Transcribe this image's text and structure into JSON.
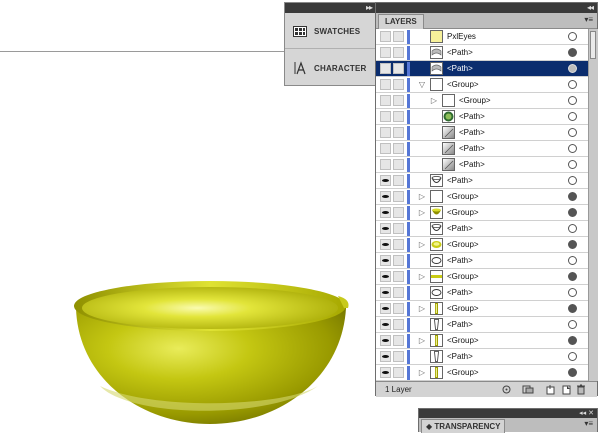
{
  "dock": {
    "swatches_label": "SWATCHES",
    "character_label": "CHARACTER",
    "collapse_glyph": "▸▸"
  },
  "layers": {
    "tab_label": "LAYERS",
    "menu_glyph": "▾≡",
    "collapse_glyph": "◂◂",
    "footer_count": "1 Layer",
    "rows": [
      {
        "label": "PxlEyes",
        "visible": false,
        "expander": "none",
        "thumb": "yellow",
        "indent": 0,
        "targeted": false,
        "selected": false
      },
      {
        "label": "<Path>",
        "visible": false,
        "expander": "none",
        "thumb": "arc",
        "indent": 0,
        "targeted": true,
        "selected": false
      },
      {
        "label": "<Path>",
        "visible": false,
        "expander": "none",
        "thumb": "arc",
        "indent": 0,
        "targeted": true,
        "selected": true
      },
      {
        "label": "<Group>",
        "visible": false,
        "expander": "open",
        "thumb": "blank",
        "indent": 0,
        "targeted": false,
        "selected": false
      },
      {
        "label": "<Group>",
        "visible": false,
        "expander": "closed",
        "thumb": "blank",
        "indent": 1,
        "targeted": false,
        "selected": false
      },
      {
        "label": "<Path>",
        "visible": false,
        "expander": "none",
        "thumb": "green-circle",
        "indent": 1,
        "targeted": false,
        "selected": false
      },
      {
        "label": "<Path>",
        "visible": false,
        "expander": "none",
        "thumb": "gray-grad",
        "indent": 1,
        "targeted": false,
        "selected": false
      },
      {
        "label": "<Path>",
        "visible": false,
        "expander": "none",
        "thumb": "gray-grad",
        "indent": 1,
        "targeted": false,
        "selected": false
      },
      {
        "label": "<Path>",
        "visible": false,
        "expander": "none",
        "thumb": "gray-grad",
        "indent": 1,
        "targeted": false,
        "selected": false
      },
      {
        "label": "<Path>",
        "visible": true,
        "expander": "none",
        "thumb": "bowl-outline",
        "indent": 0,
        "targeted": false,
        "selected": false
      },
      {
        "label": "<Group>",
        "visible": true,
        "expander": "closed",
        "thumb": "blank",
        "indent": 0,
        "targeted": true,
        "selected": false
      },
      {
        "label": "<Group>",
        "visible": true,
        "expander": "closed",
        "thumb": "olive-bowl",
        "indent": 0,
        "targeted": true,
        "selected": false
      },
      {
        "label": "<Path>",
        "visible": true,
        "expander": "none",
        "thumb": "bowl-outline",
        "indent": 0,
        "targeted": false,
        "selected": false
      },
      {
        "label": "<Group>",
        "visible": true,
        "expander": "closed",
        "thumb": "yellow-ellipse",
        "indent": 0,
        "targeted": true,
        "selected": false
      },
      {
        "label": "<Path>",
        "visible": true,
        "expander": "none",
        "thumb": "ring",
        "indent": 0,
        "targeted": false,
        "selected": false
      },
      {
        "label": "<Group>",
        "visible": true,
        "expander": "closed",
        "thumb": "yellow-bar",
        "indent": 0,
        "targeted": true,
        "selected": false
      },
      {
        "label": "<Path>",
        "visible": true,
        "expander": "none",
        "thumb": "ring",
        "indent": 0,
        "targeted": false,
        "selected": false
      },
      {
        "label": "<Group>",
        "visible": true,
        "expander": "closed",
        "thumb": "vertical-bar",
        "indent": 0,
        "targeted": true,
        "selected": false
      },
      {
        "label": "<Path>",
        "visible": true,
        "expander": "none",
        "thumb": "vertical-outline",
        "indent": 0,
        "targeted": false,
        "selected": false
      },
      {
        "label": "<Group>",
        "visible": true,
        "expander": "closed",
        "thumb": "vertical-bar",
        "indent": 0,
        "targeted": true,
        "selected": false
      },
      {
        "label": "<Path>",
        "visible": true,
        "expander": "none",
        "thumb": "vertical-outline",
        "indent": 0,
        "targeted": false,
        "selected": false
      },
      {
        "label": "<Group>",
        "visible": true,
        "expander": "closed",
        "thumb": "vertical-bar",
        "indent": 0,
        "targeted": true,
        "selected": false
      }
    ]
  },
  "transparency": {
    "tab_label": "◆ TRANSPARENCY",
    "menu_glyph": "▾≡",
    "controls_glyph": "◂◂ ✕"
  },
  "colors": {
    "selection": "#0b2d6e",
    "layer_color": "#5677d6",
    "bowl_rim": "#d9dd2a",
    "bowl_body": "#9ea000"
  }
}
